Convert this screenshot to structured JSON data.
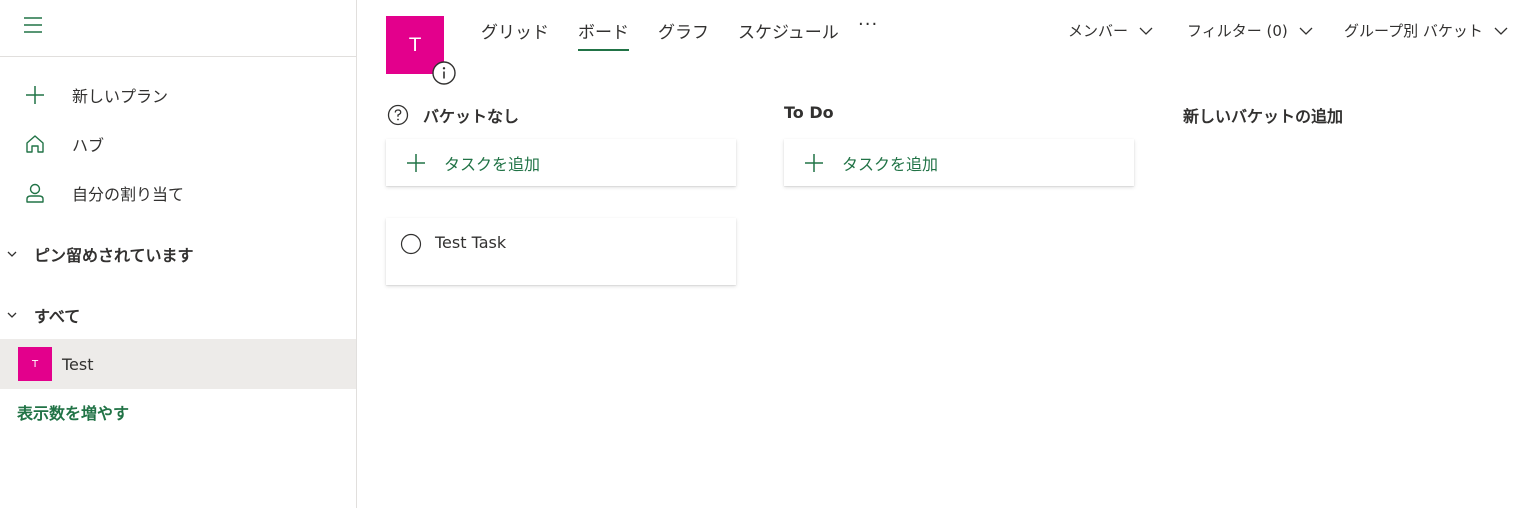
{
  "sidebar": {
    "nav": [
      {
        "label": "新しいプラン",
        "icon": "plus-icon"
      },
      {
        "label": "ハブ",
        "icon": "home-icon"
      },
      {
        "label": "自分の割り当て",
        "icon": "person-icon"
      }
    ],
    "sections": {
      "pinned": "ピン留めされています",
      "all": "すべて"
    },
    "plans": [
      {
        "initial": "T",
        "name": "Test",
        "color": "#e3008c"
      }
    ],
    "show_more": "表示数を増やす"
  },
  "header": {
    "plan_initial": "T",
    "plan_color": "#e3008c",
    "tabs": [
      {
        "label": "グリッド",
        "active": false
      },
      {
        "label": "ボード",
        "active": true
      },
      {
        "label": "グラフ",
        "active": false
      },
      {
        "label": "スケジュール",
        "active": false
      }
    ],
    "more": "···",
    "members": "メンバー",
    "filter": "フィルター (0)",
    "group_by": "グループ別 バケット"
  },
  "board": {
    "buckets": [
      {
        "name": "バケットなし",
        "add_task": "タスクを追加",
        "tasks": [
          {
            "title": "Test Task",
            "completed": false
          }
        ]
      },
      {
        "name": "To Do",
        "add_task": "タスクを追加",
        "tasks": []
      }
    ],
    "new_bucket": "新しいバケットの追加"
  },
  "colors": {
    "accent": "#217346",
    "plan": "#e3008c",
    "selected_row": "#edebe9"
  }
}
